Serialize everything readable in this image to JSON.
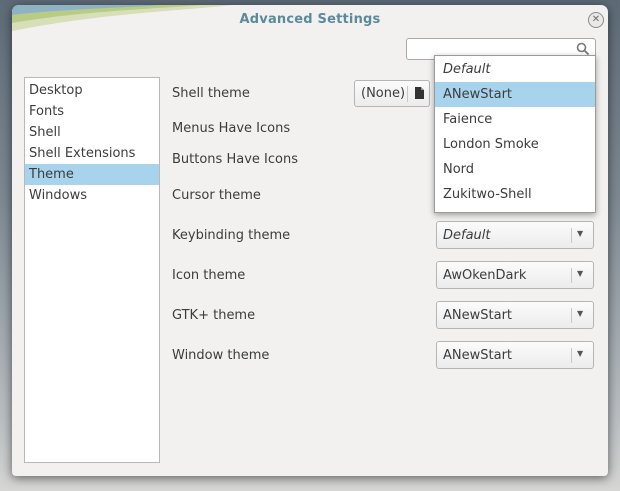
{
  "window": {
    "title": "Advanced Settings"
  },
  "search": {
    "placeholder": ""
  },
  "sidebar": {
    "items": [
      {
        "label": "Desktop"
      },
      {
        "label": "Fonts"
      },
      {
        "label": "Shell"
      },
      {
        "label": "Shell Extensions"
      },
      {
        "label": "Theme"
      },
      {
        "label": "Windows"
      }
    ],
    "selected": "Theme"
  },
  "settings": {
    "shell_theme": {
      "label": "Shell theme",
      "button_label": "(None)"
    },
    "menus_have_icons": {
      "label": "Menus Have Icons"
    },
    "buttons_have_icons": {
      "label": "Buttons Have Icons"
    },
    "cursor_theme": {
      "label": "Cursor theme"
    },
    "keybinding_theme": {
      "label": "Keybinding theme",
      "value": "Default"
    },
    "icon_theme": {
      "label": "Icon theme",
      "value": "AwOkenDark"
    },
    "gtk_theme": {
      "label": "GTK+ theme",
      "value": "ANewStart"
    },
    "window_theme": {
      "label": "Window theme",
      "value": "ANewStart"
    }
  },
  "dropdown": {
    "options": [
      {
        "label": "Default"
      },
      {
        "label": "ANewStart"
      },
      {
        "label": "Faience"
      },
      {
        "label": "London Smoke"
      },
      {
        "label": "Nord"
      },
      {
        "label": "Zukitwo-Shell"
      }
    ],
    "selected": "ANewStart"
  },
  "colors": {
    "selection": "#a7d4ec",
    "title": "#5b8a9a"
  }
}
